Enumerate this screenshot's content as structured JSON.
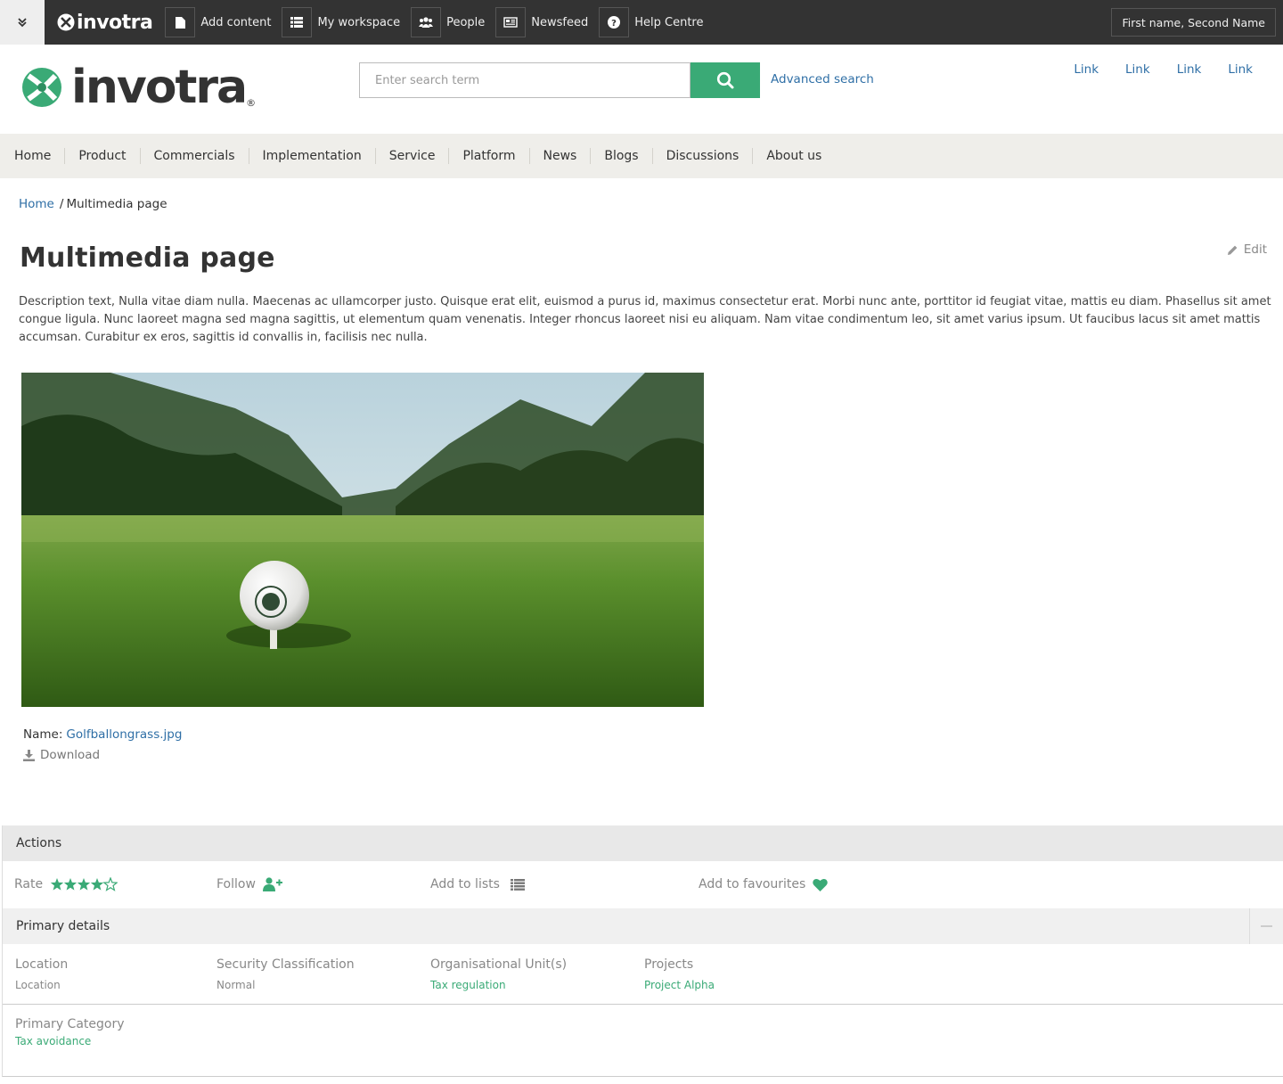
{
  "adminbar": {
    "logo_text": "invotra",
    "items": [
      {
        "label": "Add content",
        "icon": "file-icon"
      },
      {
        "label": "My workspace",
        "icon": "list-icon"
      },
      {
        "label": "People",
        "icon": "users-icon"
      },
      {
        "label": "Newsfeed",
        "icon": "newspaper-icon"
      },
      {
        "label": "Help Centre",
        "icon": "question-icon"
      }
    ],
    "user_name": "First name, Second Name"
  },
  "header": {
    "brand_text": "invotra",
    "brand_reg": "®",
    "search_placeholder": "Enter search term",
    "advanced_search": "Advanced search",
    "links": [
      "Link",
      "Link",
      "Link",
      "Link"
    ]
  },
  "nav": [
    "Home",
    "Product",
    "Commercials",
    "Implementation",
    "Service",
    "Platform",
    "News",
    "Blogs",
    "Discussions",
    "About us"
  ],
  "breadcrumb": {
    "home": "Home",
    "separator": "/",
    "current": "Multimedia page"
  },
  "page": {
    "title": "Multimedia page",
    "edit_label": "Edit",
    "description": "Description text, Nulla vitae diam nulla. Maecenas ac ullamcorper justo. Quisque erat elit, euismod a purus id, maximus consectetur erat. Morbi nunc ante, porttitor id feugiat vitae, mattis eu diam. Phasellus sit amet congue ligula. Nunc laoreet magna sed magna sagittis, ut elementum quam venenatis. Integer rhoncus laoreet nisi eu aliquam. Nam vitae condimentum leo, sit amet varius ipsum. Ut faucibus lacus sit amet mattis accumsan. Curabitur ex eros, sagittis id convallis in, facilisis nec nulla.",
    "file_name_label": "Name:",
    "file_name": "Golfballongrass.jpg",
    "download_label": "Download"
  },
  "actions": {
    "header": "Actions",
    "rate_label": "Rate",
    "rating": 4,
    "rating_max": 5,
    "follow_label": "Follow",
    "add_to_lists_label": "Add to lists",
    "add_to_favourites_label": "Add to favourites"
  },
  "primary_details": {
    "header": "Primary details",
    "fields": [
      {
        "label": "Location",
        "value": "Location"
      },
      {
        "label": "Security Classification",
        "value": "Normal"
      },
      {
        "label": "Organisational Unit(s)",
        "value": "Tax regulation"
      },
      {
        "label": "Projects",
        "value": "Project Alpha"
      }
    ],
    "category_label": "Primary Category",
    "category_value": "Tax avoidance"
  },
  "colors": {
    "accent": "#3aaa76",
    "link": "#2f6fa6",
    "adminbar": "#333333"
  }
}
